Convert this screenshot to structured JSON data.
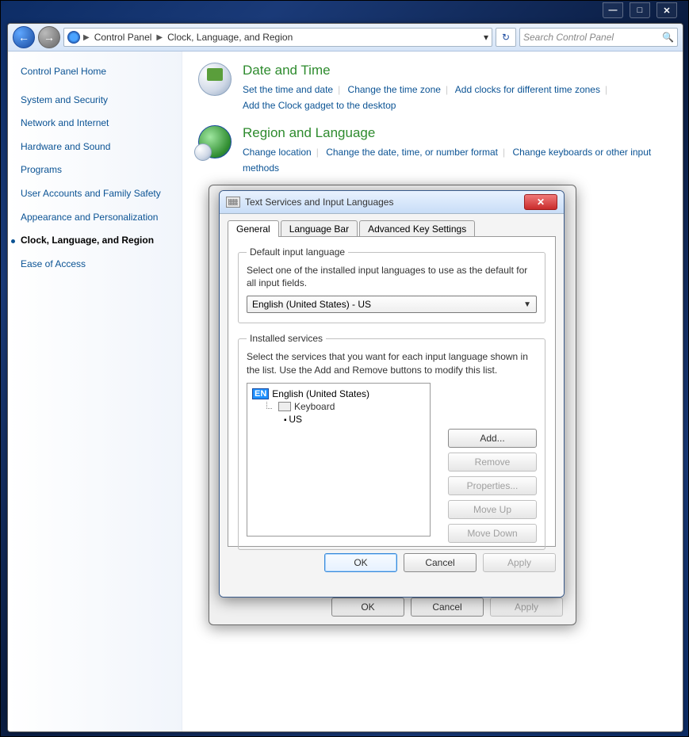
{
  "winControls": {
    "min": "—",
    "max": "□",
    "close": "✕"
  },
  "nav": {
    "back": "←",
    "forward": "→",
    "refresh": "↻",
    "pathIconLabel": "nav",
    "dropIndicator": "▾",
    "crumbs": [
      "Control Panel",
      "Clock, Language, and Region"
    ],
    "chevron": "▶",
    "search_placeholder": "Search Control Panel",
    "magnifier": "🔍"
  },
  "sidebar": {
    "home": "Control Panel Home",
    "items": [
      "System and Security",
      "Network and Internet",
      "Hardware and Sound",
      "Programs",
      "User Accounts and Family Safety",
      "Appearance and Personalization",
      "Clock, Language, and Region",
      "Ease of Access"
    ],
    "currentIndex": 6
  },
  "content": {
    "cat1": {
      "title": "Date and Time",
      "links": [
        "Set the time and date",
        "Change the time zone",
        "Add clocks for different time zones",
        "Add the Clock gadget to the desktop"
      ]
    },
    "cat2": {
      "title": "Region and Language",
      "links": [
        "Change location",
        "Change the date, time, or number format",
        "Change keyboards or other input methods"
      ]
    }
  },
  "dialog": {
    "title": "Text Services and Input Languages",
    "closeLabel": "✕",
    "tabs": [
      "General",
      "Language Bar",
      "Advanced Key Settings"
    ],
    "activeTab": 0,
    "group1": {
      "legend": "Default input language",
      "desc": "Select one of the installed input languages to use as the default for all input fields.",
      "selectValue": "English (United States) - US",
      "selectArrow": "▼"
    },
    "group2": {
      "legend": "Installed services",
      "desc": "Select the services that you want for each input language shown in the list. Use the Add and Remove buttons to modify this list.",
      "tree": {
        "badge": "EN",
        "root": "English (United States)",
        "branch": "Keyboard",
        "leaf": "US"
      },
      "buttons": {
        "add": "Add...",
        "remove": "Remove",
        "properties": "Properties...",
        "moveup": "Move Up",
        "movedown": "Move Down"
      }
    },
    "mainButtons": {
      "ok": "OK",
      "cancel": "Cancel",
      "apply": "Apply"
    }
  },
  "backDialog": {
    "ok": "OK",
    "cancel": "Cancel",
    "apply": "Apply"
  }
}
